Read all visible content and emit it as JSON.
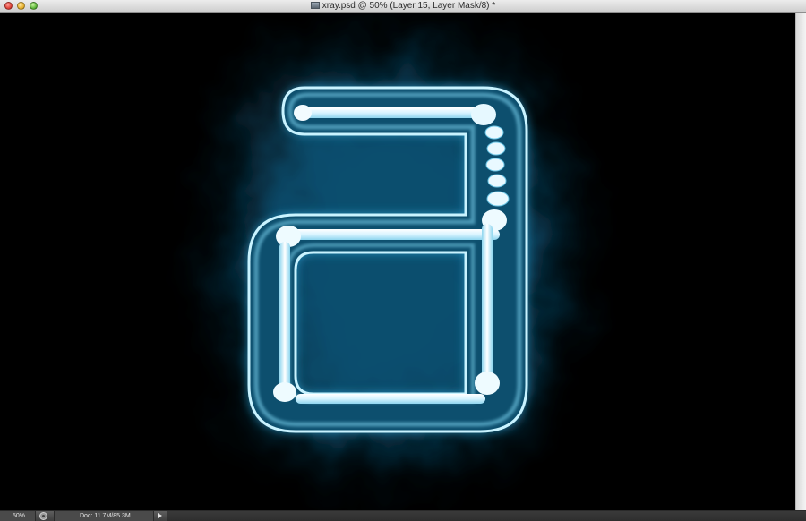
{
  "window": {
    "title": "xray.psd @ 50% (Layer 15, Layer Mask/8) *",
    "document_icon": "photoshop-document-icon"
  },
  "canvas": {
    "background_color": "#000000",
    "glow_color": "#1e7fb0",
    "edge_color": "#bff0ff"
  },
  "statusbar": {
    "zoom": "50%",
    "doc_info": "Doc: 11.7M/85.3M"
  }
}
